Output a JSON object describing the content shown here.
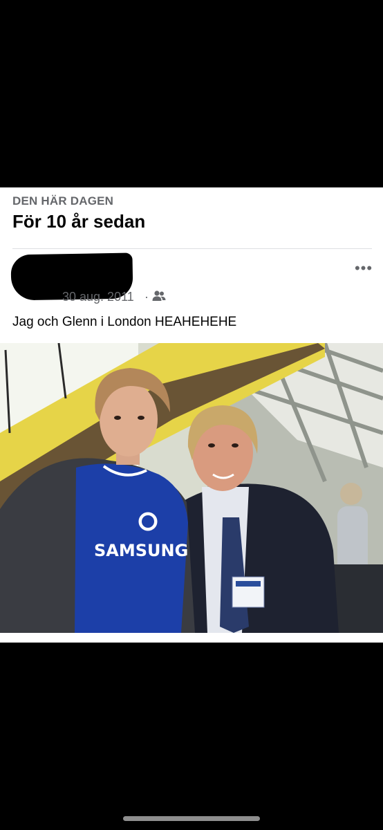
{
  "memory": {
    "label": "DEN HÄR DAGEN",
    "title": "För 10 år sedan"
  },
  "post": {
    "date": "30 aug. 2011",
    "separator": "·",
    "audience_icon": "friends-icon",
    "more_icon": "more-options-icon",
    "more_glyph": "•••",
    "text": "Jag och Glenn i London HEAHEHEHE"
  },
  "photo": {
    "shirt_text": "SAMSUNG",
    "colors": {
      "jersey": "#1c3fa8",
      "beam": "#e8d84a",
      "suit": "#1e2230"
    }
  }
}
